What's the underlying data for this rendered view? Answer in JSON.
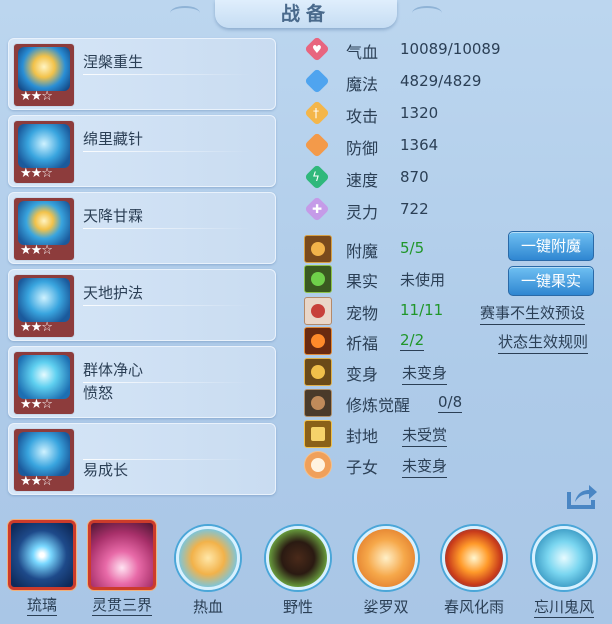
{
  "title": "战备",
  "skills": [
    {
      "name": "涅槃重生",
      "sub": "",
      "stars": "★★☆",
      "icon": "phoenix-skill-icon"
    },
    {
      "name": "绵里藏针",
      "sub": "",
      "stars": "★★☆",
      "icon": "needle-skill-icon"
    },
    {
      "name": "天降甘霖",
      "sub": "",
      "stars": "★★☆",
      "icon": "rain-skill-icon"
    },
    {
      "name": "天地护法",
      "sub": "",
      "stars": "★★☆",
      "icon": "guardian-skill-icon"
    },
    {
      "name": "群体净心",
      "sub": "愤怒",
      "stars": "★★☆",
      "icon": "purify-skill-icon"
    },
    {
      "name": "",
      "sub": "易成长",
      "stars": "★★☆",
      "icon": "growth-skill-icon"
    }
  ],
  "stats": [
    {
      "label": "气血",
      "value": "10089/10089",
      "icon": "heart-icon",
      "color": "#e8657f"
    },
    {
      "label": "魔法",
      "value": "4829/4829",
      "icon": "mana-icon",
      "color": "#4fa4ef"
    },
    {
      "label": "攻击",
      "value": "1320",
      "icon": "sword-icon",
      "color": "#f4b64a"
    },
    {
      "label": "防御",
      "value": "1364",
      "icon": "shield-icon",
      "color": "#f39a4a"
    },
    {
      "label": "速度",
      "value": "870",
      "icon": "speed-icon",
      "color": "#2fb87b"
    },
    {
      "label": "灵力",
      "value": "722",
      "icon": "spirit-icon",
      "color": "#c59be8"
    }
  ],
  "attrs": [
    {
      "label": "附魔",
      "value": "5/5",
      "icon": "enchant-icon"
    },
    {
      "label": "果实",
      "value": "未使用",
      "icon": "fruit-icon"
    },
    {
      "label": "宠物",
      "value": "11/11",
      "icon": "pet-icon"
    },
    {
      "label": "祈福",
      "value": "2/2",
      "icon": "blessing-icon"
    },
    {
      "label": "变身",
      "value": "未变身",
      "icon": "transform-icon"
    },
    {
      "label": "修炼觉醒",
      "value": "0/8",
      "icon": "cultivation-icon"
    },
    {
      "label": "封地",
      "value": "未受赏",
      "icon": "fief-icon"
    },
    {
      "label": "子女",
      "value": "未变身",
      "icon": "child-icon"
    }
  ],
  "buttons": {
    "enchant": "一键附魔",
    "fruit": "一键果实"
  },
  "links": {
    "preset": "赛事不生效预设",
    "rules": "状态生效规则"
  },
  "pets": [
    {
      "name": "琉璃",
      "icon": "glaze-pet-icon"
    },
    {
      "name": "灵贯三界",
      "icon": "spirit-realm-pet-icon"
    },
    {
      "name": "热血",
      "icon": "passion-pet-icon"
    },
    {
      "name": "野性",
      "icon": "wild-pet-icon"
    },
    {
      "name": "娑罗双",
      "icon": "sala-pet-icon"
    },
    {
      "name": "春风化雨",
      "icon": "spring-breeze-pet-icon"
    },
    {
      "name": "忘川鬼风",
      "icon": "ghost-wind-pet-icon"
    }
  ]
}
